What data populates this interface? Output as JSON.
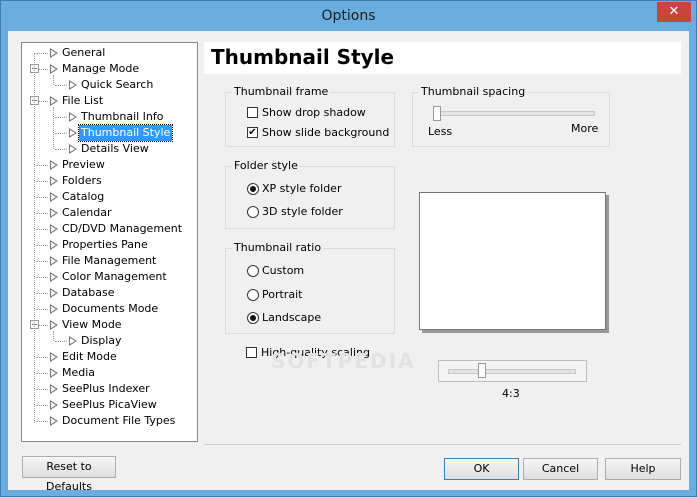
{
  "window": {
    "title": "Options",
    "close_glyph": "✕"
  },
  "tree": {
    "items": [
      {
        "label": "General",
        "level": 0,
        "expander": ""
      },
      {
        "label": "Manage Mode",
        "level": 0,
        "expander": "−"
      },
      {
        "label": "Quick Search",
        "level": 1,
        "expander": ""
      },
      {
        "label": "File List",
        "level": 0,
        "expander": "−"
      },
      {
        "label": "Thumbnail Info",
        "level": 1,
        "expander": ""
      },
      {
        "label": "Thumbnail Style",
        "level": 1,
        "expander": "",
        "selected": true
      },
      {
        "label": "Details View",
        "level": 1,
        "expander": ""
      },
      {
        "label": "Preview",
        "level": 0,
        "expander": ""
      },
      {
        "label": "Folders",
        "level": 0,
        "expander": ""
      },
      {
        "label": "Catalog",
        "level": 0,
        "expander": ""
      },
      {
        "label": "Calendar",
        "level": 0,
        "expander": ""
      },
      {
        "label": "CD/DVD Management",
        "level": 0,
        "expander": ""
      },
      {
        "label": "Properties Pane",
        "level": 0,
        "expander": ""
      },
      {
        "label": "File Management",
        "level": 0,
        "expander": ""
      },
      {
        "label": "Color Management",
        "level": 0,
        "expander": ""
      },
      {
        "label": "Database",
        "level": 0,
        "expander": ""
      },
      {
        "label": "Documents Mode",
        "level": 0,
        "expander": ""
      },
      {
        "label": "View Mode",
        "level": 0,
        "expander": "−"
      },
      {
        "label": "Display",
        "level": 1,
        "expander": ""
      },
      {
        "label": "Edit Mode",
        "level": 0,
        "expander": ""
      },
      {
        "label": "Media",
        "level": 0,
        "expander": ""
      },
      {
        "label": "SeePlus Indexer",
        "level": 0,
        "expander": ""
      },
      {
        "label": "SeePlus PicaView",
        "level": 0,
        "expander": ""
      },
      {
        "label": "Document File Types",
        "level": 0,
        "expander": ""
      }
    ]
  },
  "panel": {
    "heading": "Thumbnail Style",
    "frame": {
      "title": "Thumbnail frame",
      "drop_shadow": {
        "label": "Show drop shadow",
        "checked": false
      },
      "slide_bg": {
        "label": "Show slide background",
        "checked": true
      }
    },
    "folder": {
      "title": "Folder style",
      "xp": {
        "label": "XP style folder",
        "selected": true
      },
      "three_d": {
        "label": "3D style folder",
        "selected": false
      }
    },
    "ratio": {
      "title": "Thumbnail ratio",
      "custom": {
        "label": "Custom",
        "selected": false
      },
      "portrait": {
        "label": "Portrait",
        "selected": false
      },
      "landscape": {
        "label": "Landscape",
        "selected": true
      }
    },
    "high_quality": {
      "label": "High-quality scaling",
      "checked": false
    },
    "spacing": {
      "title": "Thumbnail spacing",
      "less": "Less",
      "more": "More",
      "level": 0.0
    },
    "ratio_value": "4:3",
    "watermark": "SOFTPEDIA"
  },
  "buttons": {
    "reset": "Reset to Defaults",
    "ok": "OK",
    "cancel": "Cancel",
    "help": "Help"
  }
}
